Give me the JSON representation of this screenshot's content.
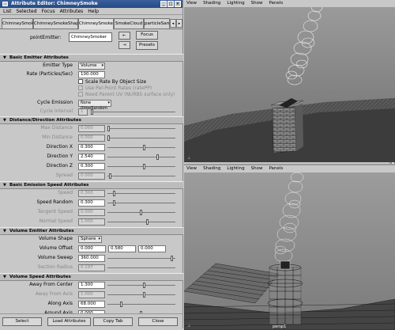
{
  "window": {
    "title": "Attribute Editor: ChimneySmoke"
  },
  "menus": [
    "List",
    "Selected",
    "Focus",
    "Attributes",
    "Help"
  ],
  "tabs": [
    "ChimneySmoke",
    "ChimneySmokeShape",
    "ChimneySmoker",
    "SmokeCloud",
    "particleSam"
  ],
  "active_tab": "ChimneySmoker",
  "node": {
    "label": "pointEmitter:",
    "value": "ChimneySmoker",
    "focus": "Focus",
    "presets": "Presets"
  },
  "basic_emitter": {
    "title": "Basic Emitter Attributes",
    "emitter_type_label": "Emitter Type",
    "emitter_type": "Volume",
    "rate_label": "Rate (Particles/Sec)",
    "rate": "100.000",
    "scale_rate": "Scale Rate By Object Size",
    "per_point": "Use Per-Point Rates (ratePP)",
    "need_parent_uv": "Need Parent UV (NURBS surface only)",
    "cycle_emission_label": "Cycle Emission",
    "cycle_emission": "None (timeRandom off)",
    "cycle_interval_label": "Cycle Interval",
    "cycle_interval": "1"
  },
  "distance": {
    "title": "Distance/Direction Attributes",
    "rows": [
      {
        "label": "Max Distance",
        "value": "0.000",
        "dim": true,
        "knob": 0.0
      },
      {
        "label": "Min Distance",
        "value": "0.000",
        "dim": true,
        "knob": 0.0
      },
      {
        "label": "Direction X",
        "value": "0.300",
        "dim": false,
        "knob": 0.55
      },
      {
        "label": "Direction Y",
        "value": "2.540",
        "dim": false,
        "knob": 0.75
      },
      {
        "label": "Direction Z",
        "value": "0.300",
        "dim": false,
        "knob": 0.55
      },
      {
        "label": "Spread",
        "value": "0.000",
        "dim": true,
        "knob": 0.02
      }
    ]
  },
  "speed": {
    "title": "Basic Emission Speed Attributes",
    "rows": [
      {
        "label": "Speed",
        "value": "0.300",
        "dim": true,
        "knob": 0.08
      },
      {
        "label": "Speed Random",
        "value": "0.300",
        "dim": false,
        "knob": 0.08
      },
      {
        "label": "Tangent Speed",
        "value": "0.000",
        "dim": true,
        "knob": 0.5
      },
      {
        "label": "Normal Speed",
        "value": "1.000",
        "dim": true,
        "knob": 0.6
      }
    ]
  },
  "volume": {
    "title": "Volume Emitter Attributes",
    "shape_label": "Volume Shape",
    "shape": "Sphere",
    "offset_label": "Volume Offset",
    "offset": [
      "0.000",
      "0.580",
      "0.000"
    ],
    "sweep_label": "Volume Sweep",
    "sweep": "360.000",
    "sweep_knob": 0.98,
    "radius_label": "Section Radius",
    "radius": "0.197"
  },
  "volume_speed": {
    "title": "Volume Speed Attributes",
    "rows": [
      {
        "label": "Away From Center",
        "value": "1.300",
        "dim": false,
        "knob": 0.55
      },
      {
        "label": "Away From Axis",
        "value": "1.000",
        "dim": true,
        "knob": 0.55
      },
      {
        "label": "Along Axis",
        "value": "68.000",
        "dim": false,
        "knob": 0.2
      },
      {
        "label": "Around Axis",
        "value": "0.000",
        "dim": false,
        "knob": 0.5
      }
    ]
  },
  "bottom": {
    "select": "Select",
    "load": "Load Attributes",
    "copy": "Copy Tab",
    "close": "Close"
  },
  "viewport_menu": [
    "View",
    "Shading",
    "Lighting",
    "Show",
    "Panels"
  ],
  "viewport_label": "persp1"
}
